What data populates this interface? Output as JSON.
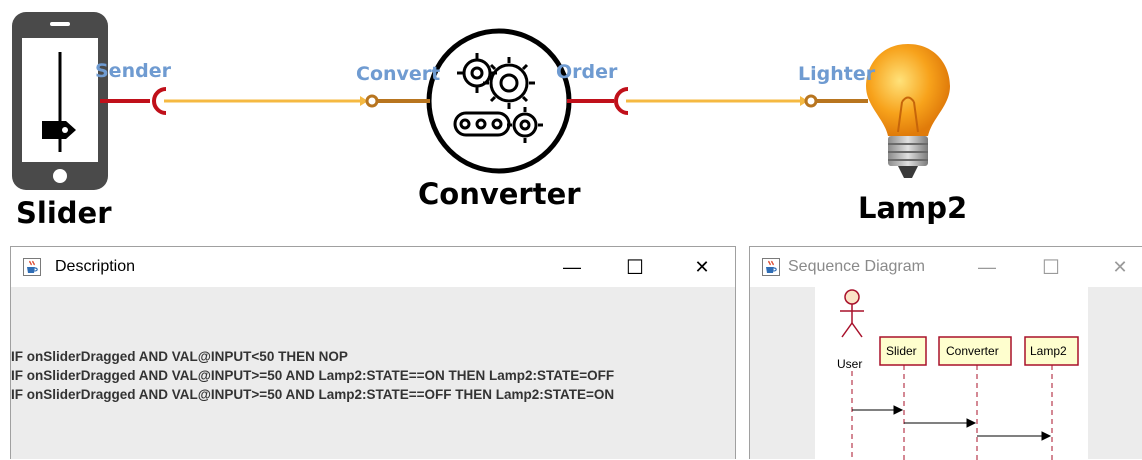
{
  "diagram": {
    "components": {
      "slider": {
        "name": "Slider"
      },
      "converter": {
        "name": "Converter"
      },
      "lamp": {
        "name": "Lamp2"
      }
    },
    "ports": {
      "sender": "Sender",
      "convert": "Convert",
      "order": "Order",
      "lighter": "Lighter"
    },
    "colors": {
      "port_label": "#6f9bd1",
      "required_port": "#c0101a",
      "connector": "#f5b942",
      "provided_port": "#b8751f"
    }
  },
  "description_window": {
    "title": "Description",
    "icon": "java-cup-icon",
    "controls": {
      "minimize": "—",
      "maximize": "☐",
      "close": "✕"
    },
    "rules": [
      "IF onSliderDragged AND VAL@INPUT<50 THEN NOP",
      "IF onSliderDragged AND VAL@INPUT>=50 AND Lamp2:STATE==ON THEN Lamp2:STATE=OFF",
      "IF onSliderDragged AND VAL@INPUT>=50 AND Lamp2:STATE==OFF THEN Lamp2:STATE=ON"
    ]
  },
  "sequence_window": {
    "title": "Sequence Diagram",
    "icon": "java-cup-icon",
    "controls": {
      "minimize": "—",
      "maximize": "☐",
      "close": "✕"
    },
    "actor": "User",
    "participants": [
      "Slider",
      "Converter",
      "Lamp2"
    ]
  }
}
